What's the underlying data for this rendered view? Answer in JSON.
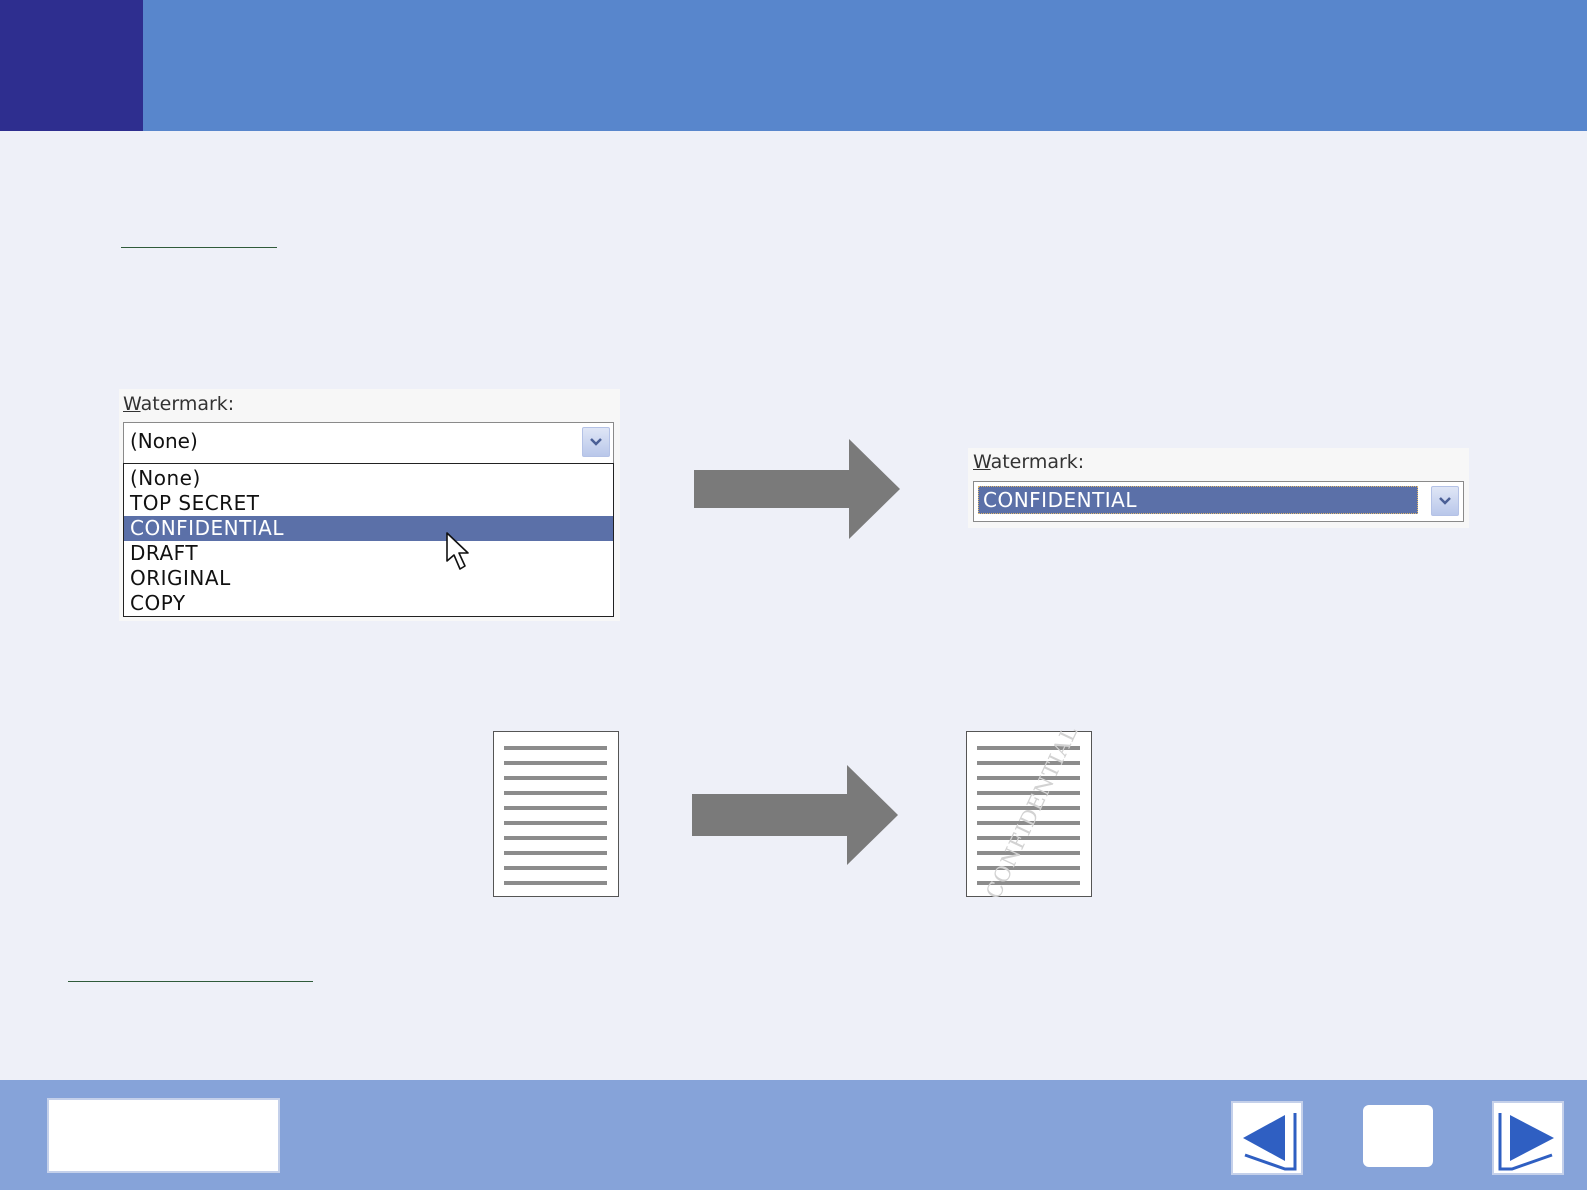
{
  "before_dialog": {
    "label_mnemonic": "W",
    "label_rest": "atermark:",
    "selected_value": "(None)",
    "dropdown_icon": "chevron-down-icon",
    "options": [
      "(None)",
      "TOP SECRET",
      "CONFIDENTIAL",
      "DRAFT",
      "ORIGINAL",
      "COPY"
    ],
    "highlighted_option": "CONFIDENTIAL",
    "cursor_icon": "mouse-pointer-icon"
  },
  "after_dialog": {
    "label_mnemonic": "W",
    "label_rest": "atermark:",
    "selected_value": "CONFIDENTIAL",
    "dropdown_icon": "chevron-down-icon"
  },
  "preview": {
    "watermark_text": "CONFIDENTIAL",
    "arrow_icon": "right-arrow-icon"
  },
  "footer": {
    "prev_icon": "triangle-left-icon",
    "next_icon": "triangle-right-icon"
  },
  "colors": {
    "header": "#5886cc",
    "header_corner": "#2e2e8f",
    "background": "#eef0f8",
    "footer": "#86a3d9",
    "selection": "#5b70a8",
    "arrow": "#7a7a7a",
    "nav_icon": "#2f5fc2"
  }
}
